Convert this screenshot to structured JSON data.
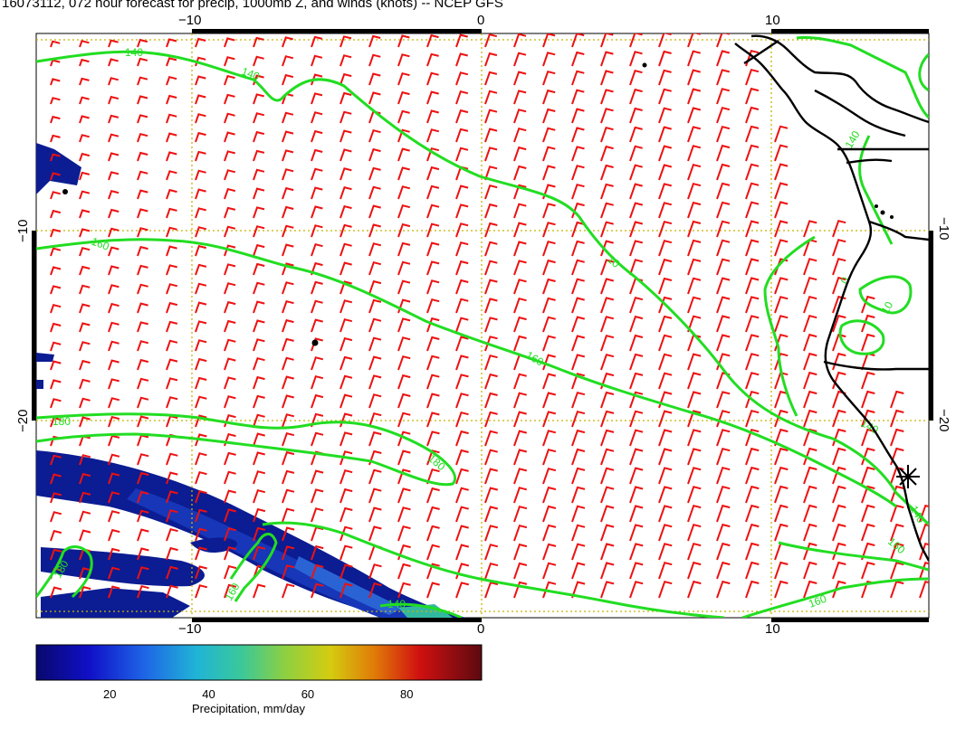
{
  "title": "16073112, 072 hour forecast for precip, 1000mb Z, and winds (knots) -- NCEP GFS",
  "map": {
    "lon_ticks": [
      "−10",
      "0",
      "10"
    ],
    "lat_ticks": [
      "−10",
      "−20"
    ],
    "contour_labels": [
      "140",
      "140",
      "160",
      "140",
      "10",
      "160",
      "180",
      "180",
      "180",
      "160",
      "140",
      "140",
      "140",
      "160",
      "160",
      "10",
      "0"
    ],
    "colors": {
      "contour": "#22dd22",
      "wind_barb": "#ee1111",
      "grid": "#c8b400",
      "coast": "#000000",
      "precip_low": "#0a1a8c",
      "precip_high": "#2a6fd0"
    }
  },
  "colorbar": {
    "ticks": [
      "20",
      "40",
      "60",
      "80"
    ],
    "label": "Precipitation, mm/day",
    "min": 5,
    "max": 95
  }
}
